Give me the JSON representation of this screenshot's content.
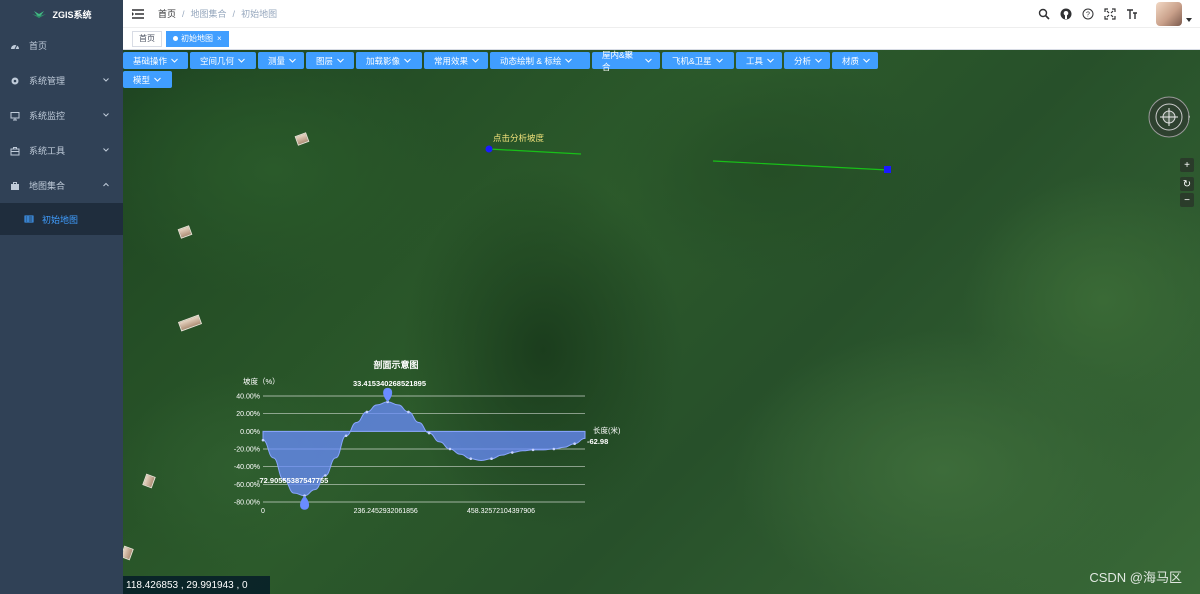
{
  "app": {
    "title": "ZGIS系统"
  },
  "sidebar": {
    "items": [
      {
        "label": "首页",
        "icon": "dashboard-icon"
      },
      {
        "label": "系统管理",
        "icon": "gear-icon",
        "expandable": true
      },
      {
        "label": "系统监控",
        "icon": "monitor-icon",
        "expandable": true
      },
      {
        "label": "系统工具",
        "icon": "toolbox-icon",
        "expandable": true
      },
      {
        "label": "地图集合",
        "icon": "briefcase-icon",
        "expandable": true,
        "expanded": true
      }
    ],
    "submenu": {
      "label": "初始地图",
      "icon": "table-icon",
      "active": true
    }
  },
  "header": {
    "breadcrumb": [
      "首页",
      "地图集合",
      "初始地图"
    ],
    "icons": [
      "search-icon",
      "github-icon",
      "question-icon",
      "fullscreen-icon",
      "font-size-icon"
    ]
  },
  "tags": [
    {
      "label": "首页",
      "active": false
    },
    {
      "label": "初始地图",
      "active": true
    }
  ],
  "toolbar": {
    "buttons": [
      "基础操作",
      "空间几何",
      "测量",
      "图层",
      "加载影像",
      "常用效果",
      "动态绘制 & 标绘",
      "屋内&聚合",
      "飞机&卫星",
      "工具",
      "分析",
      "材质",
      "模型"
    ]
  },
  "map": {
    "slope_label": "点击分析坡度",
    "coordinates": "118.426853 ,  29.991943 ,  0",
    "watermark": "CSDN @海马区",
    "zoom": {
      "in": "+",
      "reset": "↻",
      "out": "−"
    }
  },
  "chart_data": {
    "type": "area",
    "title": "剖面示意图",
    "ylabel": "坡度（%）",
    "xlabel": "长度(米)",
    "ylim": [
      -80,
      40
    ],
    "yticks": [
      "40.00%",
      "20.00%",
      "0.00%",
      "-20.00%",
      "-40.00%",
      "-60.00%",
      "-80.00%"
    ],
    "xticks": [
      "0",
      "236.2452932061856",
      "458.32572104397906"
    ],
    "x": [
      0,
      20,
      40,
      60,
      80,
      100,
      120,
      140,
      160,
      180,
      200,
      220,
      240,
      260,
      280,
      300,
      320,
      340,
      360,
      380,
      400,
      420,
      440,
      460,
      480,
      500,
      520,
      540,
      560,
      580,
      600,
      620
    ],
    "values": [
      -10,
      -30,
      -55,
      -70,
      -72.9,
      -66,
      -50,
      -30,
      -5,
      10,
      22,
      30,
      33.4,
      30,
      22,
      10,
      -2,
      -12,
      -20,
      -26,
      -31,
      -33,
      -31,
      -27,
      -24,
      -22,
      -21,
      -21,
      -20,
      -18,
      -14,
      -8
    ],
    "max_label": "33.415340268521895",
    "min_label": "-72.90555387547755",
    "end_label": "-62.98",
    "grid": true,
    "color": "#6a8cff"
  }
}
